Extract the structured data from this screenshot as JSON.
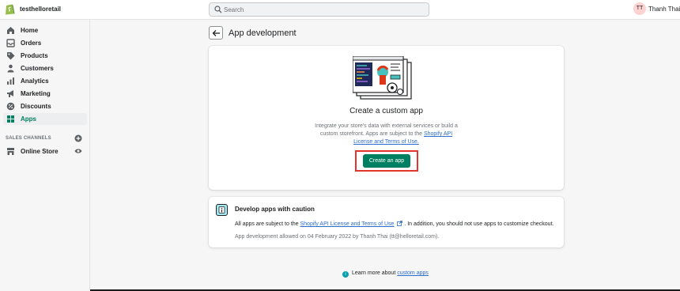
{
  "header": {
    "store_name": "testhelloretail",
    "search_placeholder": "Search",
    "user_initials": "TT",
    "user_name": "Thanh Thai"
  },
  "sidebar": {
    "items": [
      {
        "label": "Home",
        "icon": "home-icon"
      },
      {
        "label": "Orders",
        "icon": "orders-icon"
      },
      {
        "label": "Products",
        "icon": "tag-icon"
      },
      {
        "label": "Customers",
        "icon": "person-icon"
      },
      {
        "label": "Analytics",
        "icon": "bar-chart-icon"
      },
      {
        "label": "Marketing",
        "icon": "megaphone-icon"
      },
      {
        "label": "Discounts",
        "icon": "discount-icon"
      },
      {
        "label": "Apps",
        "icon": "apps-icon"
      }
    ],
    "active": "Apps",
    "sales_channels_label": "SALES CHANNELS",
    "channels": [
      {
        "label": "Online Store"
      }
    ]
  },
  "page": {
    "title": "App development"
  },
  "custom_app_card": {
    "title": "Create a custom app",
    "description_prefix": "Integrate your store's data with external services or build a custom storefront. Apps are subject to the ",
    "description_link": "Shopify API License and Terms of Use.",
    "button_label": "Create an app"
  },
  "caution_card": {
    "title": "Develop apps with caution",
    "text_prefix": "All apps are subject to the ",
    "text_link": "Shopify API License and Terms of Use",
    "text_suffix": ". In addition, you should not use apps to customize checkout.",
    "allowed_note": "App development allowed on 04 February 2022 by Thanh Thai (tt@helloretail.com)."
  },
  "footer": {
    "learn_prefix": "Learn more about ",
    "learn_link": "custom apps"
  },
  "colors": {
    "primary": "#008060",
    "link": "#2c6ecb",
    "highlight": "#e3342f"
  }
}
